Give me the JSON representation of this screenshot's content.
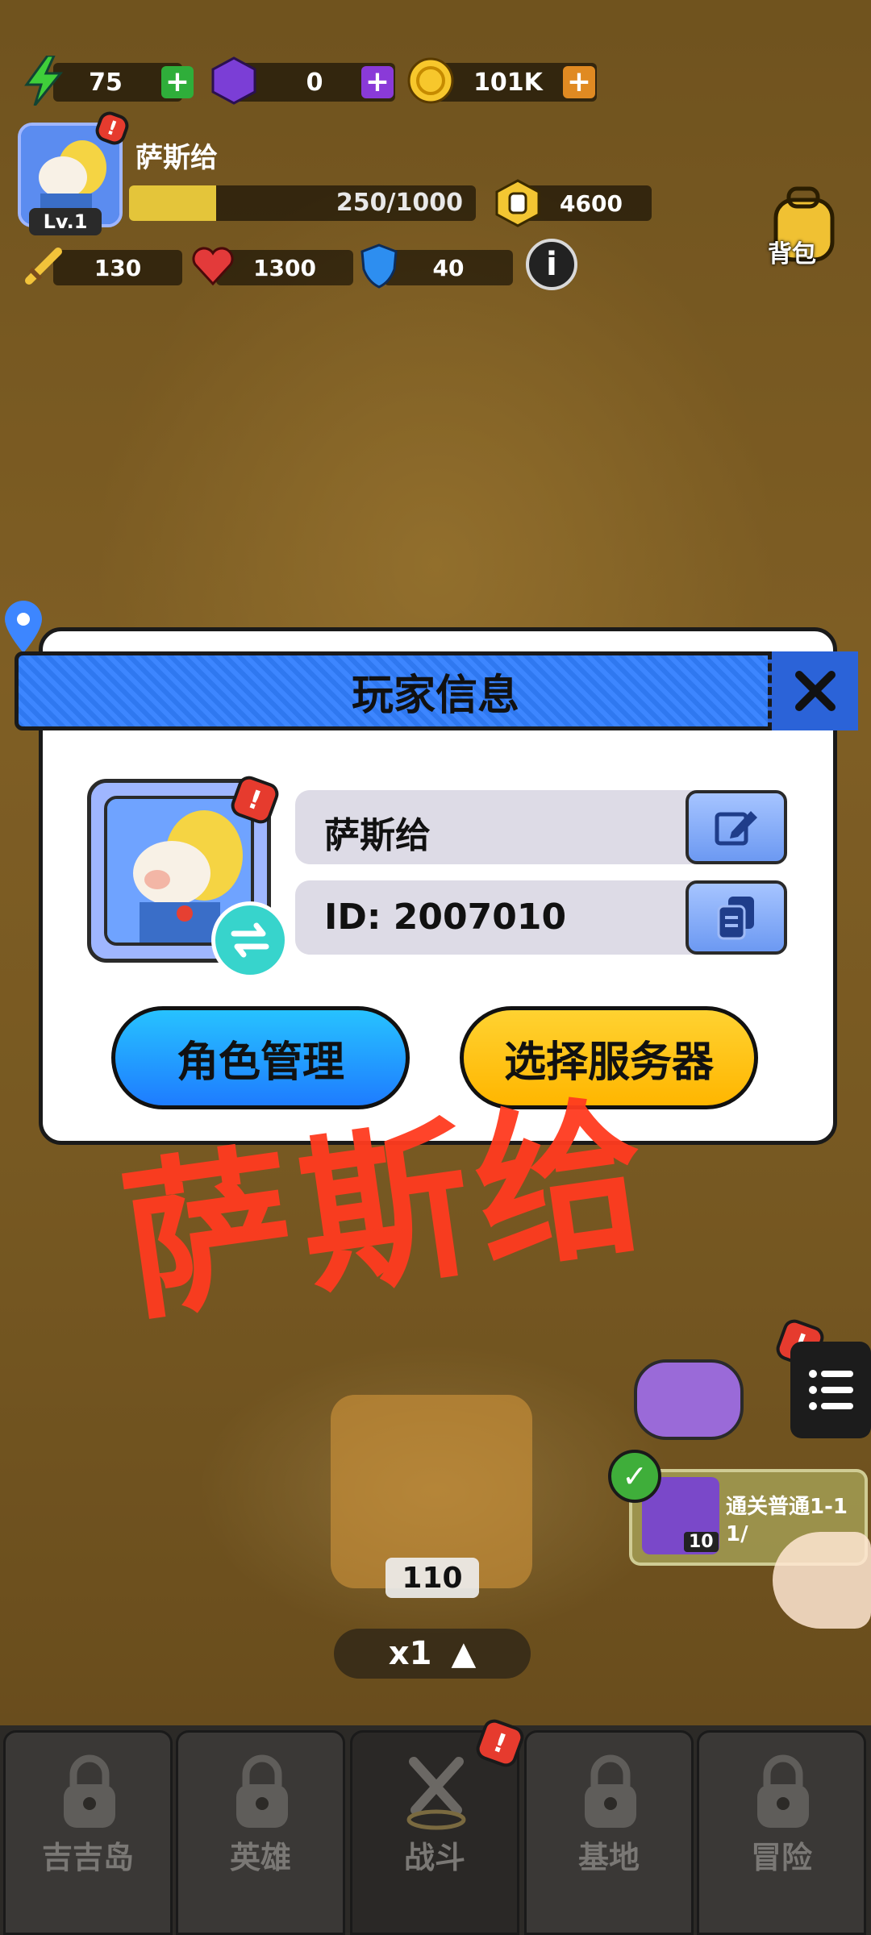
{
  "hud": {
    "energy": "75",
    "gems": "0",
    "coins": "101K",
    "player_name": "萨斯给",
    "level": "Lv.1",
    "xp_text": "250/1000",
    "xp_progress": 0.25,
    "power": "4600",
    "attack": "130",
    "health": "1300",
    "defense": "40",
    "bag_label": "背包"
  },
  "dialog": {
    "title": "玩家信息",
    "player_name": "萨斯给",
    "player_id": "ID: 2007010",
    "role_button": "角色管理",
    "server_button": "选择服务器"
  },
  "watermark": "萨斯给",
  "scene": {
    "chest_count": "110",
    "speed": "x1",
    "quest_text": "通关普通1-1",
    "quest_progress": "1/",
    "quest_gem_count": "10"
  },
  "nav": {
    "items": [
      {
        "label": "吉吉岛"
      },
      {
        "label": "英雄"
      },
      {
        "label": "战斗"
      },
      {
        "label": "基地"
      },
      {
        "label": "冒险"
      }
    ]
  },
  "colors": {
    "dialog_header": "#3d86ff",
    "blue_button": "#1e7cff",
    "yellow_button": "#ffb600",
    "watermark": "#ff3b1f"
  }
}
